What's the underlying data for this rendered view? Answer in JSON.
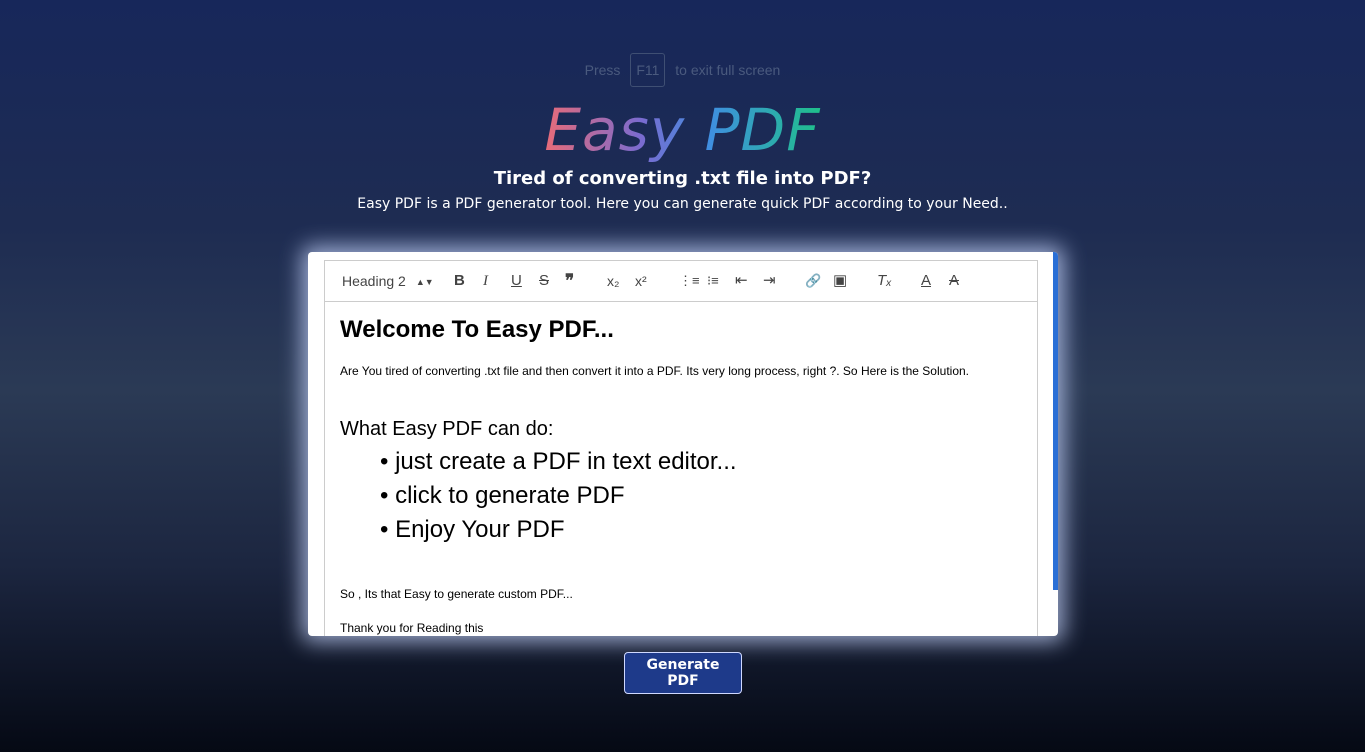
{
  "hint": {
    "before": "Press",
    "key": "F11",
    "after": "to exit full screen"
  },
  "brand": {
    "logo": "Easy PDF"
  },
  "intro": {
    "tagline": "Tired of converting .txt file into PDF?",
    "description": "Easy PDF is a PDF generator tool. Here you can generate quick PDF according to your Need.."
  },
  "toolbar": {
    "heading_select": "Heading 2",
    "items": [
      {
        "name": "bold-icon",
        "glyph": "B"
      },
      {
        "name": "italic-icon",
        "glyph": "I"
      },
      {
        "name": "underline-icon",
        "glyph": "U"
      },
      {
        "name": "strike-icon",
        "glyph": "S"
      },
      {
        "name": "quote-icon",
        "glyph": "❞"
      },
      {
        "name": "subscript-icon",
        "glyph": "x₂"
      },
      {
        "name": "superscript-icon",
        "glyph": "x²"
      },
      {
        "name": "ordered-list-icon",
        "glyph": "⋮≡"
      },
      {
        "name": "bullet-list-icon",
        "glyph": "⁝≡"
      },
      {
        "name": "indent-decrease-icon",
        "glyph": "⇤"
      },
      {
        "name": "indent-increase-icon",
        "glyph": "⇥"
      },
      {
        "name": "link-icon",
        "glyph": "🔗"
      },
      {
        "name": "image-icon",
        "glyph": "▣"
      },
      {
        "name": "clear-format-icon",
        "glyph": "Tₓ"
      },
      {
        "name": "text-color-icon",
        "glyph": "A"
      },
      {
        "name": "background-color-icon",
        "glyph": "A"
      }
    ]
  },
  "editor": {
    "heading": "Welcome To Easy PDF...",
    "paragraph": "Are You tired of converting .txt file and then convert it into a PDF. Its very long process, right ?. So Here is the Solution.",
    "features_title": "What Easy PDF can do:",
    "features": [
      "just create a PDF in text editor...",
      "click to generate PDF",
      "Enjoy Your PDF"
    ],
    "closing": "So , Its that Easy to generate custom PDF...",
    "thanks": "Thank you for Reading this"
  },
  "actions": {
    "generate": "Generate PDF"
  },
  "colors": {
    "accent": "#1e3a8a",
    "scrollbar": "#2a6fd6"
  }
}
